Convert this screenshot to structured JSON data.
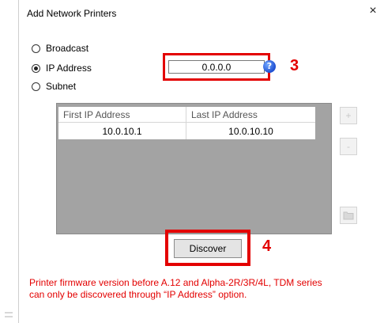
{
  "window": {
    "title": "Add Network Printers",
    "close_symbol": "×"
  },
  "modes": [
    {
      "label": "Broadcast",
      "selected": false
    },
    {
      "label": "IP Address",
      "selected": true
    },
    {
      "label": "Subnet",
      "selected": false
    }
  ],
  "ip_address": {
    "value": "0.0.0.0"
  },
  "help_icon": {
    "symbol": "?"
  },
  "annotations": {
    "step3": "3",
    "step4": "4",
    "color": "#e30000"
  },
  "subnet_table": {
    "columns": [
      "First IP Address",
      "Last IP Address"
    ],
    "rows": [
      [
        "10.0.10.1",
        "10.0.10.10"
      ]
    ]
  },
  "side_buttons": {
    "add_symbol": "+",
    "remove_symbol": "-",
    "icons": [
      "plus-icon",
      "minus-icon",
      "folder-icon"
    ]
  },
  "discover_label": "Discover",
  "warning_lines": [
    "Printer firmware version before A.12 and Alpha-2R/3R/4L, TDM series",
    "can only be discovered through “IP Address” option."
  ]
}
